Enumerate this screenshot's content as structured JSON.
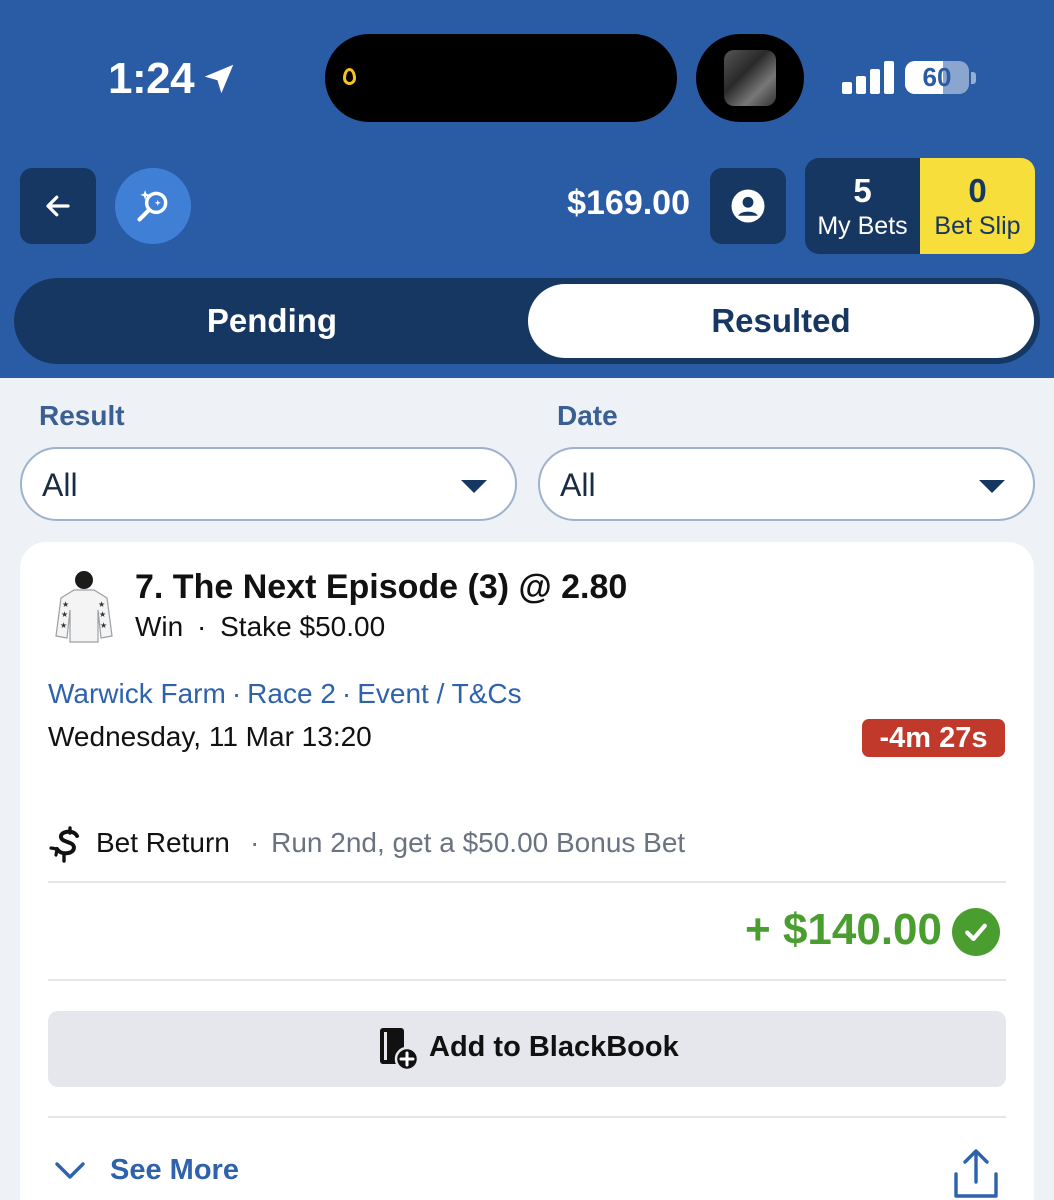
{
  "status_bar": {
    "time": "1:24",
    "battery_percent": "60",
    "battery_level": 0.6,
    "icons": [
      "location-arrow-icon",
      "signal-icon",
      "battery-icon"
    ]
  },
  "top_bar": {
    "balance": "$169.00",
    "my_bets": {
      "count": "5",
      "label": "My Bets"
    },
    "bet_slip": {
      "count": "0",
      "label": "Bet Slip"
    },
    "icons": [
      "back-arrow-icon",
      "search-sparkle-icon",
      "account-icon"
    ]
  },
  "tabs": {
    "pending": "Pending",
    "resulted": "Resulted",
    "active": "resulted"
  },
  "filters": {
    "result": {
      "label": "Result",
      "value": "All"
    },
    "date": {
      "label": "Date",
      "value": "All"
    }
  },
  "bet": {
    "title": "7. The Next Episode (3) @ 2.80",
    "bet_type": "Win",
    "stake": "Stake $50.00",
    "venue": "Warwick Farm",
    "race": "Race 2",
    "event_link": "Event / T&Cs",
    "datetime": "Wednesday, 11 Mar 13:20",
    "countdown": "-4m 27s",
    "bet_return_label": "Bet Return",
    "bet_return_desc": "Run 2nd, get a $50.00 Bonus Bet",
    "winnings": "+ $140.00",
    "blackbook_label": "Add to BlackBook",
    "see_more": "See More"
  },
  "colors": {
    "header_blue": "#2a5ca6",
    "dark_navy": "#173763",
    "bet_slip_yellow": "#f7de3a",
    "win_green": "#4a9e2f",
    "countdown_red": "#c0392b",
    "link_blue": "#2f62ad"
  }
}
